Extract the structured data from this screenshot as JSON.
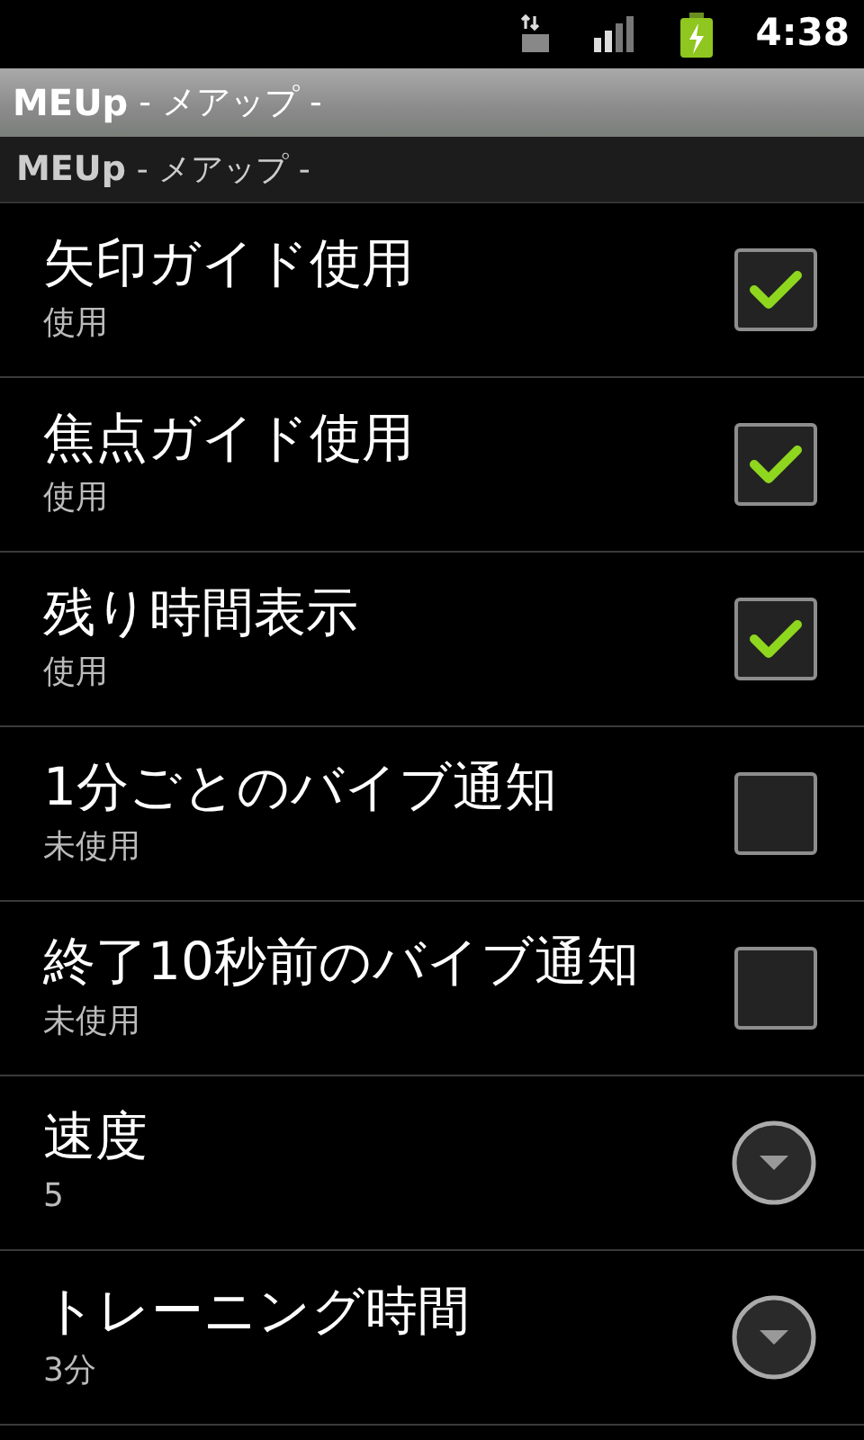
{
  "status_bar": {
    "time": "4:38"
  },
  "title_bar": {
    "app_name": "MEUp",
    "subtitle": "- メアップ -"
  },
  "category": {
    "app_name": "MEUp",
    "subtitle": "- メアップ -"
  },
  "preferences": [
    {
      "kind": "checkbox",
      "title": "矢印ガイド使用",
      "summary": "使用",
      "checked": true
    },
    {
      "kind": "checkbox",
      "title": "焦点ガイド使用",
      "summary": "使用",
      "checked": true
    },
    {
      "kind": "checkbox",
      "title": "残り時間表示",
      "summary": "使用",
      "checked": true
    },
    {
      "kind": "checkbox",
      "title": "1分ごとのバイブ通知",
      "summary": "未使用",
      "checked": false
    },
    {
      "kind": "checkbox",
      "title": "終了10秒前のバイブ通知",
      "summary": "未使用",
      "checked": false
    },
    {
      "kind": "list",
      "title": "速度",
      "summary": "5"
    },
    {
      "kind": "list",
      "title": "トレーニング時間",
      "summary": "3分"
    }
  ]
}
